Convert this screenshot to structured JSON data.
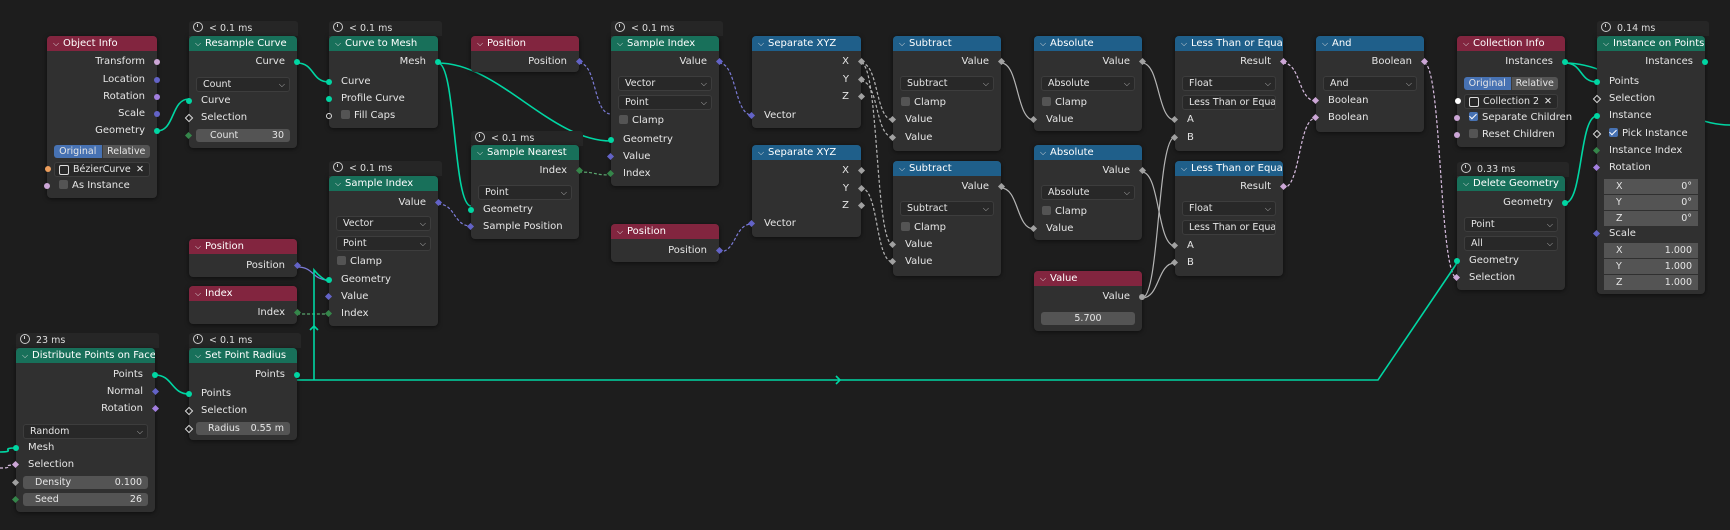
{
  "theme": {
    "geometry_header": "#18705a",
    "input_header": "#82253f",
    "converter_header": "#1f5f8a",
    "wire_geometry": "#00d6a3",
    "socket_geometry": "#00d6a3",
    "socket_vector": "#6363c7",
    "socket_float": "#a1a1a1",
    "socket_int": "#35864a",
    "socket_bool": "#cca6d6",
    "socket_instance": "#e6e6e6",
    "socket_object": "#ed9e5c",
    "accent": "#4772b3"
  },
  "nodes": {
    "object_info": {
      "title": "Object Info",
      "outputs": [
        "Transform",
        "Location",
        "Rotation",
        "Scale",
        "Geometry"
      ],
      "seg": [
        "Original",
        "Relative"
      ],
      "object": "BézierCurve",
      "as_instance": "As Instance"
    },
    "resample_curve": {
      "time": "< 0.1 ms",
      "title": "Resample Curve",
      "out": "Curve",
      "mode": "Count",
      "in_curve": "Curve",
      "in_sel": "Selection",
      "count_label": "Count",
      "count_value": "30"
    },
    "curve_to_mesh": {
      "time": "< 0.1 ms",
      "title": "Curve to Mesh",
      "out": "Mesh",
      "in_curve": "Curve",
      "in_profile": "Profile Curve",
      "fill_caps": "Fill Caps"
    },
    "position_1": {
      "title": "Position",
      "out": "Position"
    },
    "sample_index_1": {
      "time": "< 0.1 ms",
      "title": "Sample Index",
      "out": "Value",
      "type": "Vector",
      "domain": "Point",
      "clamp": "Clamp",
      "in_geo": "Geometry",
      "in_value": "Value",
      "in_index": "Index"
    },
    "sample_nearest": {
      "time": "< 0.1 ms",
      "title": "Sample Nearest",
      "out": "Index",
      "domain": "Point",
      "in_geo": "Geometry",
      "in_pos": "Sample Position"
    },
    "sample_index_2": {
      "time": "< 0.1 ms",
      "title": "Sample Index",
      "out": "Value",
      "type": "Vector",
      "domain": "Point",
      "clamp": "Clamp",
      "in_geo": "Geometry",
      "in_value": "Value",
      "in_index": "Index"
    },
    "position_2": {
      "title": "Position",
      "out": "Position"
    },
    "index": {
      "title": "Index",
      "out": "Index"
    },
    "position_3": {
      "title": "Position",
      "out": "Position"
    },
    "separate_1": {
      "title": "Separate XYZ",
      "outs": [
        "X",
        "Y",
        "Z"
      ],
      "in": "Vector"
    },
    "separate_2": {
      "title": "Separate XYZ",
      "outs": [
        "X",
        "Y",
        "Z"
      ],
      "in": "Vector"
    },
    "subtract_1": {
      "title": "Subtract",
      "out": "Value",
      "op": "Subtract",
      "clamp": "Clamp",
      "ins": [
        "Value",
        "Value"
      ]
    },
    "subtract_2": {
      "title": "Subtract",
      "out": "Value",
      "op": "Subtract",
      "clamp": "Clamp",
      "ins": [
        "Value",
        "Value"
      ]
    },
    "absolute_1": {
      "title": "Absolute",
      "out": "Value",
      "op": "Absolute",
      "clamp": "Clamp",
      "in": "Value"
    },
    "absolute_2": {
      "title": "Absolute",
      "out": "Value",
      "op": "Absolute",
      "clamp": "Clamp",
      "in": "Value"
    },
    "value": {
      "title": "Value",
      "out": "Value",
      "val": "5.700"
    },
    "compare_1": {
      "title": "Less Than or Equal",
      "out": "Result",
      "type": "Float",
      "op": "Less Than or Equal",
      "ins": [
        "A",
        "B"
      ]
    },
    "compare_2": {
      "title": "Less Than or Equal",
      "out": "Result",
      "type": "Float",
      "op": "Less Than or Equal",
      "ins": [
        "A",
        "B"
      ]
    },
    "and": {
      "title": "And",
      "out": "Boolean",
      "op": "And",
      "ins": [
        "Boolean",
        "Boolean"
      ]
    },
    "collection_info": {
      "title": "Collection Info",
      "out": "Instances",
      "seg": [
        "Original",
        "Relative"
      ],
      "collection": "Collection 2",
      "sep_children": "Separate Children",
      "reset_children": "Reset Children"
    },
    "delete_geometry": {
      "time": "0.33 ms",
      "title": "Delete Geometry",
      "out": "Geometry",
      "domain": "Point",
      "mode": "All",
      "ins": [
        "Geometry",
        "Selection"
      ]
    },
    "instance_on_points": {
      "time": "0.14 ms",
      "title": "Instance on Points",
      "out": "Instances",
      "ins": [
        "Points",
        "Selection",
        "Instance"
      ],
      "pick": "Pick Instance",
      "inst_index": "Instance Index",
      "rotation": "Rotation",
      "rot": [
        [
          "X",
          "0°"
        ],
        [
          "Y",
          "0°"
        ],
        [
          "Z",
          "0°"
        ]
      ],
      "scale": "Scale",
      "scl": [
        [
          "X",
          "1.000"
        ],
        [
          "Y",
          "1.000"
        ],
        [
          "Z",
          "1.000"
        ]
      ]
    },
    "distribute": {
      "time": "23 ms",
      "title": "Distribute Points on Faces",
      "outs": [
        "Points",
        "Normal",
        "Rotation"
      ],
      "mode": "Random",
      "in_mesh": "Mesh",
      "in_sel": "Selection",
      "density_label": "Density",
      "density": "0.100",
      "seed_label": "Seed",
      "seed": "26"
    },
    "set_radius": {
      "time": "< 0.1 ms",
      "title": "Set Point Radius",
      "out": "Points",
      "in_pts": "Points",
      "in_sel": "Selection",
      "radius_label": "Radius",
      "radius": "0.55 m"
    }
  }
}
